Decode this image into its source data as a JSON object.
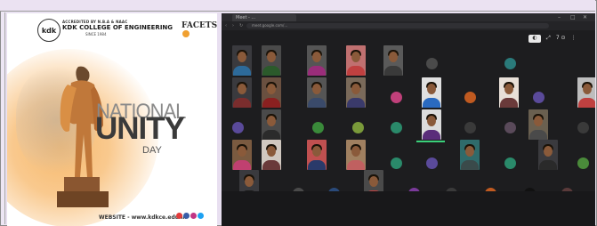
{
  "poster": {
    "logo_text": "kdk",
    "accreditation": "ACCREDITED BY N.B.A & NAAC",
    "college_name": "KDK COLLEGE OF ENGINEERING",
    "since": "SINCE 1984",
    "brand": "FACETS",
    "title_line1": "NATIONAL",
    "title_line2": "UNITY",
    "title_line3": "DAY",
    "website": "WEBSITE - www.kdkce.edu.in",
    "colors": {
      "accent_orange": "#f0a030",
      "title_dark": "#3a3a3a",
      "title_gray": "#8a8a8a"
    }
  },
  "meeting": {
    "tab_title": "Meet - ...",
    "url": "meet.google.com/...",
    "controls": [
      "◐",
      "⤢",
      "7 ⊙",
      "⋮"
    ],
    "window_controls": [
      "–",
      "□",
      "✕"
    ],
    "colors": {
      "background": "#1d1d1f"
    }
  }
}
